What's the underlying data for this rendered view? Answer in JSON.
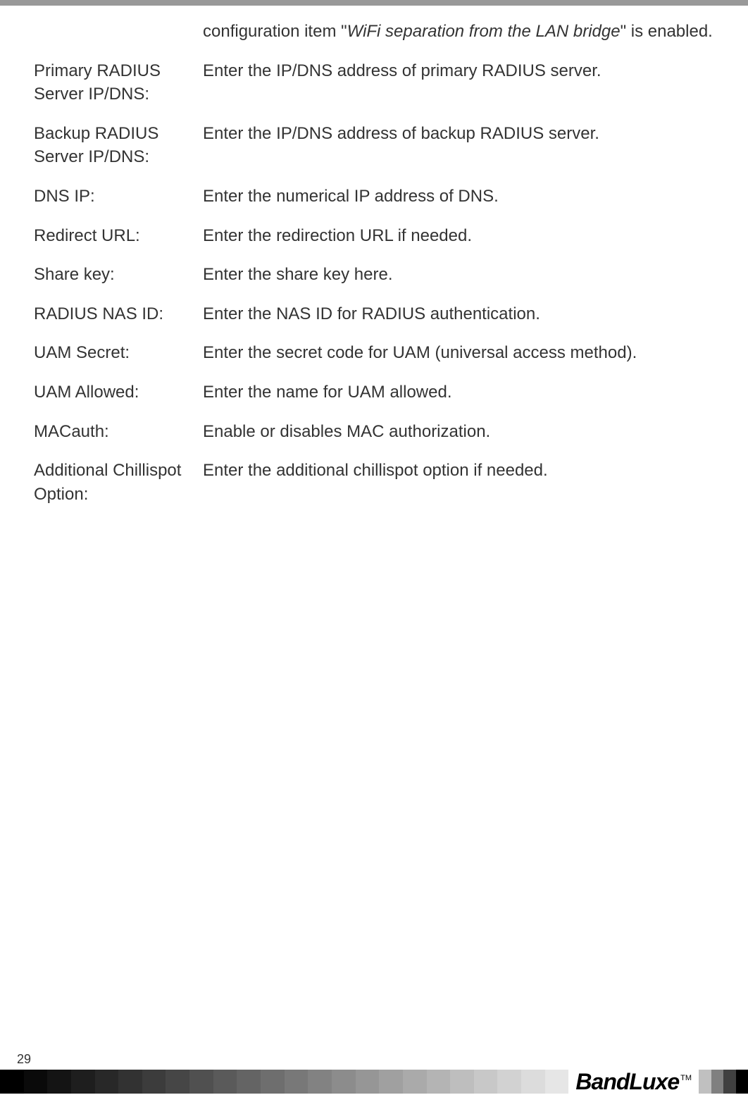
{
  "intro": {
    "prefix": "configuration item \"",
    "italic": "WiFi separation from the LAN bridge",
    "suffix": "\" is enabled."
  },
  "rows": [
    {
      "label": "Primary RADIUS Server IP/DNS:",
      "desc": "Enter the IP/DNS address of primary RADIUS server."
    },
    {
      "label": "Backup RADIUS Server IP/DNS:",
      "desc": "Enter the IP/DNS address of backup RADIUS server."
    },
    {
      "label": "DNS IP:",
      "desc": "Enter the numerical IP address of DNS."
    },
    {
      "label": "Redirect URL:",
      "desc": "Enter the redirection URL if needed."
    },
    {
      "label": "Share key:",
      "desc": "Enter the share key here."
    },
    {
      "label": "RADIUS NAS ID:",
      "desc": "Enter the NAS ID for RADIUS authentication."
    },
    {
      "label": "UAM Secret:",
      "desc": "Enter the secret code for UAM (universal access method)."
    },
    {
      "label": "UAM Allowed:",
      "desc": "Enter the name for UAM allowed."
    },
    {
      "label": "MACauth:",
      "desc": "Enable or disables MAC authorization."
    },
    {
      "label": "Additional Chillispot Option:",
      "desc": "Enter the additional chillispot option if needed."
    }
  ],
  "page_number": "29",
  "logo": "BandLuxe",
  "tm": "TM",
  "gradient_colors": [
    "#000000",
    "#0a0a0a",
    "#141414",
    "#1e1e1e",
    "#282828",
    "#323232",
    "#3c3c3c",
    "#464646",
    "#505050",
    "#5a5a5a",
    "#646464",
    "#6e6e6e",
    "#787878",
    "#828282",
    "#8c8c8c",
    "#969696",
    "#a0a0a0",
    "#aaaaaa",
    "#b4b4b4",
    "#bebebe",
    "#c8c8c8",
    "#d2d2d2",
    "#dcdcdc",
    "#e6e6e6"
  ],
  "right_colors": [
    "#c0c0c0",
    "#808080",
    "#404040",
    "#000000"
  ]
}
